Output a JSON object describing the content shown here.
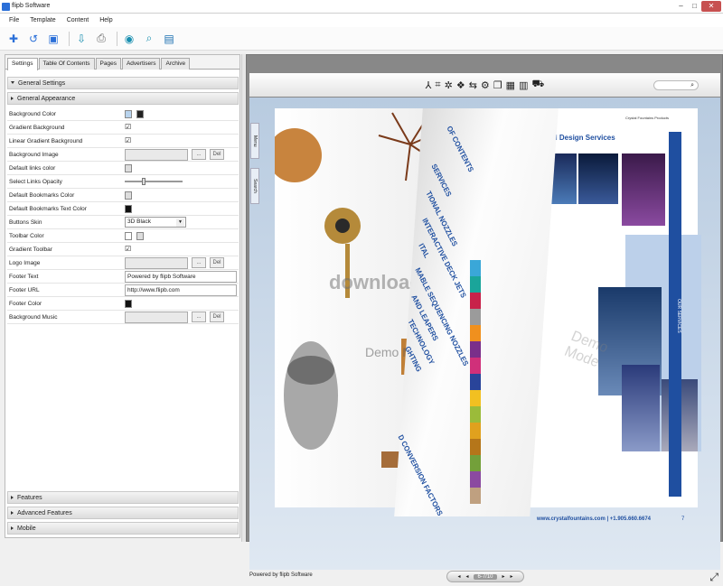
{
  "window": {
    "title": "flipb Software"
  },
  "menu": [
    "File",
    "Template",
    "Content",
    "Help"
  ],
  "tabs": [
    "Settings",
    "Table Of Contents",
    "Pages",
    "Advertisers",
    "Archive"
  ],
  "sections": {
    "general_settings": "General Settings",
    "general_appearance": "General Appearance",
    "features": "Features",
    "advanced_features": "Advanced Features",
    "mobile": "Mobile"
  },
  "props": {
    "bg_color": "Background Color",
    "gradient_bg": "Gradient Background",
    "linear_gradient_bg": "Linear Gradient Background",
    "bg_image": "Background Image",
    "default_links_color": "Default links color",
    "select_links_opacity": "Select Links Opacity",
    "default_bookmarks_color": "Default Bookmarks Color",
    "default_bookmarks_text_color": "Default Bookmarks Text Color",
    "buttons_skin": "Buttons Skin",
    "toolbar_color": "Toolbar Color",
    "gradient_toolbar": "Gradient Toolbar",
    "logo_image": "Logo Image",
    "footer_text": "Footer Text",
    "footer_url": "Footer URL",
    "footer_color": "Footer Color",
    "background_music": "Background Music"
  },
  "values": {
    "buttons_skin": "3D Black",
    "footer_text": "Powered by flipb Software",
    "footer_url": "http://www.flipb.com",
    "ellipsis": "...",
    "del": "Del"
  },
  "preview": {
    "sidetabs": [
      "Menu",
      "Search"
    ],
    "right_heading": "Engineering and Design Services",
    "right_small": "Crystal Fountains Products",
    "bluebar": "OUR SERVICES",
    "curl_lines": [
      "OF CONTENTS",
      "SERVICES",
      "TIONAL NOZZLES",
      "INTERACTIVE DECK JETS",
      "ITAL",
      "MABLE SEQUENCING NOZZLES",
      "AND LEAPERS",
      "TECHNOLOGY",
      "GHTING",
      "D CONVERSION FACTORS"
    ],
    "url": "www.crystalfountains.com  |  +1.905.660.6674",
    "page_num": "7",
    "footer": "Powered by flipb Software",
    "pager": "6-7/10",
    "wm1": "download",
    "wm2": "Demo Mode",
    "wm3": "Demo Mode",
    "colors": [
      "#3aa7d8",
      "#1aa59a",
      "#c8224a",
      "#9b9b9b",
      "#f0901e",
      "#7a2f8a",
      "#d0307a",
      "#29449a",
      "#f2c021",
      "#9bbb3a",
      "#e0a11e",
      "#b5761a",
      "#73a03a",
      "#8b4aa0",
      "#bfa080"
    ]
  }
}
